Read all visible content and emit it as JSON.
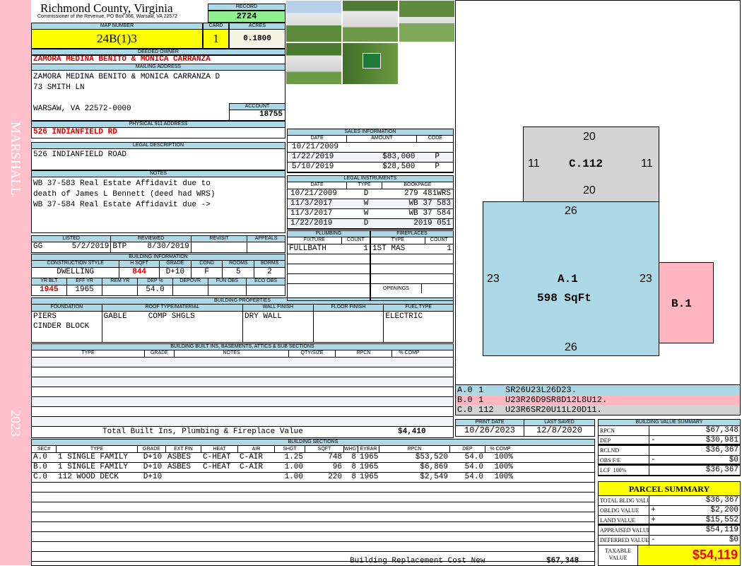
{
  "sidebar": {
    "name": "MARSHALL",
    "year": "2023"
  },
  "header": {
    "county": "Richmond County, Virginia",
    "office": "Commissioner of the Revenue, PO Box 366, Warsaw, VA 22572",
    "record_label": "RECORD",
    "record": "2724",
    "map_label": "MAP NUMBER",
    "map_number": "24B(1)3",
    "card_label": "CARD",
    "card": "1",
    "acres_label": "ACRES",
    "acres": "0.1800"
  },
  "owner": {
    "label": "DEEDED OWNER",
    "name": "ZAMORA MEDINA BENITO & MONICA CARRANZA"
  },
  "mailing": {
    "label": "MAILING ADDRESS",
    "line1": "ZAMORA MEDINA BENITO & MONICA CARRANZA D",
    "line2": "73 SMITH LN",
    "line3": "WARSAW, VA 22572-0000",
    "account_label": "ACCOUNT",
    "account": "18755"
  },
  "physical": {
    "label": "PHYSICAL 911 ADDRESS",
    "value": "526 INDIANFIELD RD"
  },
  "legal": {
    "label": "LEGAL DESCRIPTION",
    "value": "526 INDIANFIELD ROAD"
  },
  "notes": {
    "label": "NOTES",
    "lines": [
      "WB 37-583 Real Estate Affidavit due to",
      "death of James L Bennett (deed had WRS)",
      "WB 37-584 Real Estate Affidavit due ->"
    ]
  },
  "review": {
    "headers": [
      "LISTED",
      "REVIEWED",
      "REVISIT",
      "APPEALS"
    ],
    "listed_by": "GG",
    "listed": "5/2/2019",
    "reviewed_by": "BTP",
    "reviewed": "8/30/2019"
  },
  "building_info": {
    "label": "BUILDING INFORMATION",
    "headers1": [
      "CONSTRUCTION STYLE",
      "H SQFT",
      "GRADE",
      "COND",
      "ROOMS",
      "BDRMS"
    ],
    "values1": [
      "DWELLING",
      "844",
      "D+10",
      "F",
      "5",
      "2"
    ],
    "headers2": [
      "YR BLT",
      "EFF YR",
      "REM YR",
      "DEP %",
      "DEPOVR",
      "FUN OBS",
      "ECO OBS"
    ],
    "values2": [
      "1945",
      "1965",
      "",
      "54.0",
      "",
      "",
      ""
    ]
  },
  "properties": {
    "label": "BUILDING PROPERTIES",
    "headers": [
      "FOUNDATION",
      "ROOF TYPE/MATERIAL",
      "WALL FINISH",
      "FLOOR FINISH",
      "FUEL TYPE"
    ],
    "foundation1": "PIERS",
    "foundation2": "CINDER BLOCK",
    "roof_type": "GABLE",
    "roof_material": "COMP SHGLS",
    "wall": "DRY WALL",
    "floor": "",
    "fuel": "ELECTRIC"
  },
  "builtins": {
    "label": "BUILDING BUILT INS, BASEMENTS, ATTICS & SUB SECTIONS",
    "headers": [
      "TYPE",
      "GRADE",
      "NOTES",
      "QTY/SIZE",
      "RPCN",
      "% COMP"
    ],
    "total_label": "Total Built Ins, Plumbing & Fireplace Value",
    "total": "$4,410"
  },
  "sections": {
    "label": "BUILDING SECTIONS",
    "headers": [
      "SEC#",
      "TYPE",
      "GRADE",
      "EXT FIN",
      "HEAT",
      "AIR",
      "SHGT",
      "SQFT",
      "WHGT",
      "EYEAR",
      "RPCN",
      "DEP",
      "% COMP"
    ],
    "rows": [
      [
        "A.0",
        "1 SINGLE FAMILY",
        "D+10",
        "ASBES",
        "C-HEAT",
        "C-AIR",
        "1.25",
        "748",
        "8",
        "1965",
        "$53,520",
        "54.0",
        "100%"
      ],
      [
        "B.0",
        "1 SINGLE FAMILY",
        "D+10",
        "ASBES",
        "C-HEAT",
        "C-AIR",
        "1.00",
        "96",
        "8",
        "1965",
        "$6,869",
        "54.0",
        "100%"
      ],
      [
        "C.0",
        "112 WOOD DECK",
        "D+10",
        "",
        "",
        "",
        "1.00",
        "220",
        "8",
        "1965",
        "$2,549",
        "54.0",
        "100%"
      ]
    ],
    "replacement_label": "Building Replacement Cost New",
    "replacement": "$67,348"
  },
  "sales": {
    "label": "SALES INFORMATION",
    "headers": [
      "DATE",
      "AMOUNT",
      "CODE"
    ],
    "rows": [
      [
        "10/21/2009",
        "",
        ""
      ],
      [
        "1/22/2019",
        "$83,000",
        "P"
      ],
      [
        "5/10/2019",
        "$28,500",
        "P"
      ]
    ]
  },
  "instruments": {
    "label": "LEGAL INSTRUMENTS",
    "headers": [
      "DATE",
      "TYPE",
      "BOOKPAGE"
    ],
    "rows": [
      [
        "10/21/2009",
        "D",
        "279 481WRS"
      ],
      [
        "11/3/2017",
        "W",
        "WB 37 583"
      ],
      [
        "11/3/2017",
        "W",
        "WB 37 584"
      ],
      [
        "1/22/2019",
        "D",
        "2019 051"
      ]
    ]
  },
  "plumbing": {
    "label": "PLUMBING",
    "headers": [
      "FIXTURE",
      "COUNT"
    ],
    "fixture": "FULLBATH",
    "count": "1"
  },
  "fireplaces": {
    "label": "FIREPLACES",
    "headers": [
      "TYPE",
      "COUNT"
    ],
    "type": "1ST MAS",
    "count": "1",
    "openings_label": "OPENINGS"
  },
  "sketch": {
    "c_label": "C.112",
    "c_top": "20",
    "c_bottom": "20",
    "c_left": "11",
    "c_right": "11",
    "a_label": "A.1",
    "a_area": "598 SqFt",
    "a_top": "26",
    "a_bottom": "26",
    "a_left": "23",
    "a_right": "23",
    "b_label": "B.1",
    "legend": [
      [
        "A.0",
        "1",
        "SR26U23L26D23."
      ],
      [
        "B.0",
        "1",
        "U23R26D9SR8D12L8U12."
      ],
      [
        "C.0",
        "112",
        "U23R6SR20U11L20D11."
      ]
    ],
    "colors": {
      "a": "#add8e6",
      "b": "#ffb6c1",
      "c": "#d3d3d3"
    }
  },
  "dates": {
    "print_label": "PRINT DATE",
    "print": "10/26/2023",
    "saved_label": "LAST SAVED",
    "saved": "12/8/2020"
  },
  "value_summary": {
    "label": "BUILDING VALUE SUMMARY",
    "rows": [
      [
        "RPCN",
        "",
        "$67,348"
      ],
      [
        "DEP",
        "-",
        "$30,981"
      ],
      [
        "RCLND",
        "",
        "$36,367"
      ],
      [
        "OBS F/E",
        "-",
        "$0"
      ],
      [
        "LCF  100%",
        "",
        "$36,367"
      ]
    ]
  },
  "parcel": {
    "label": "PARCEL SUMMARY",
    "rows": [
      [
        "TOTAL BLDG VALUE",
        "",
        "$36,367"
      ],
      [
        "OBLDG VALUE",
        "+",
        "$2,200"
      ],
      [
        "LAND VALUE",
        "+",
        "$15,552"
      ],
      [
        "APPRAISED VALUE",
        "",
        "$54,119"
      ],
      [
        "DEFERRED VALUE",
        "-",
        "$0"
      ]
    ],
    "taxable_label": "TAXABLE VALUE",
    "taxable": "$54,119"
  }
}
